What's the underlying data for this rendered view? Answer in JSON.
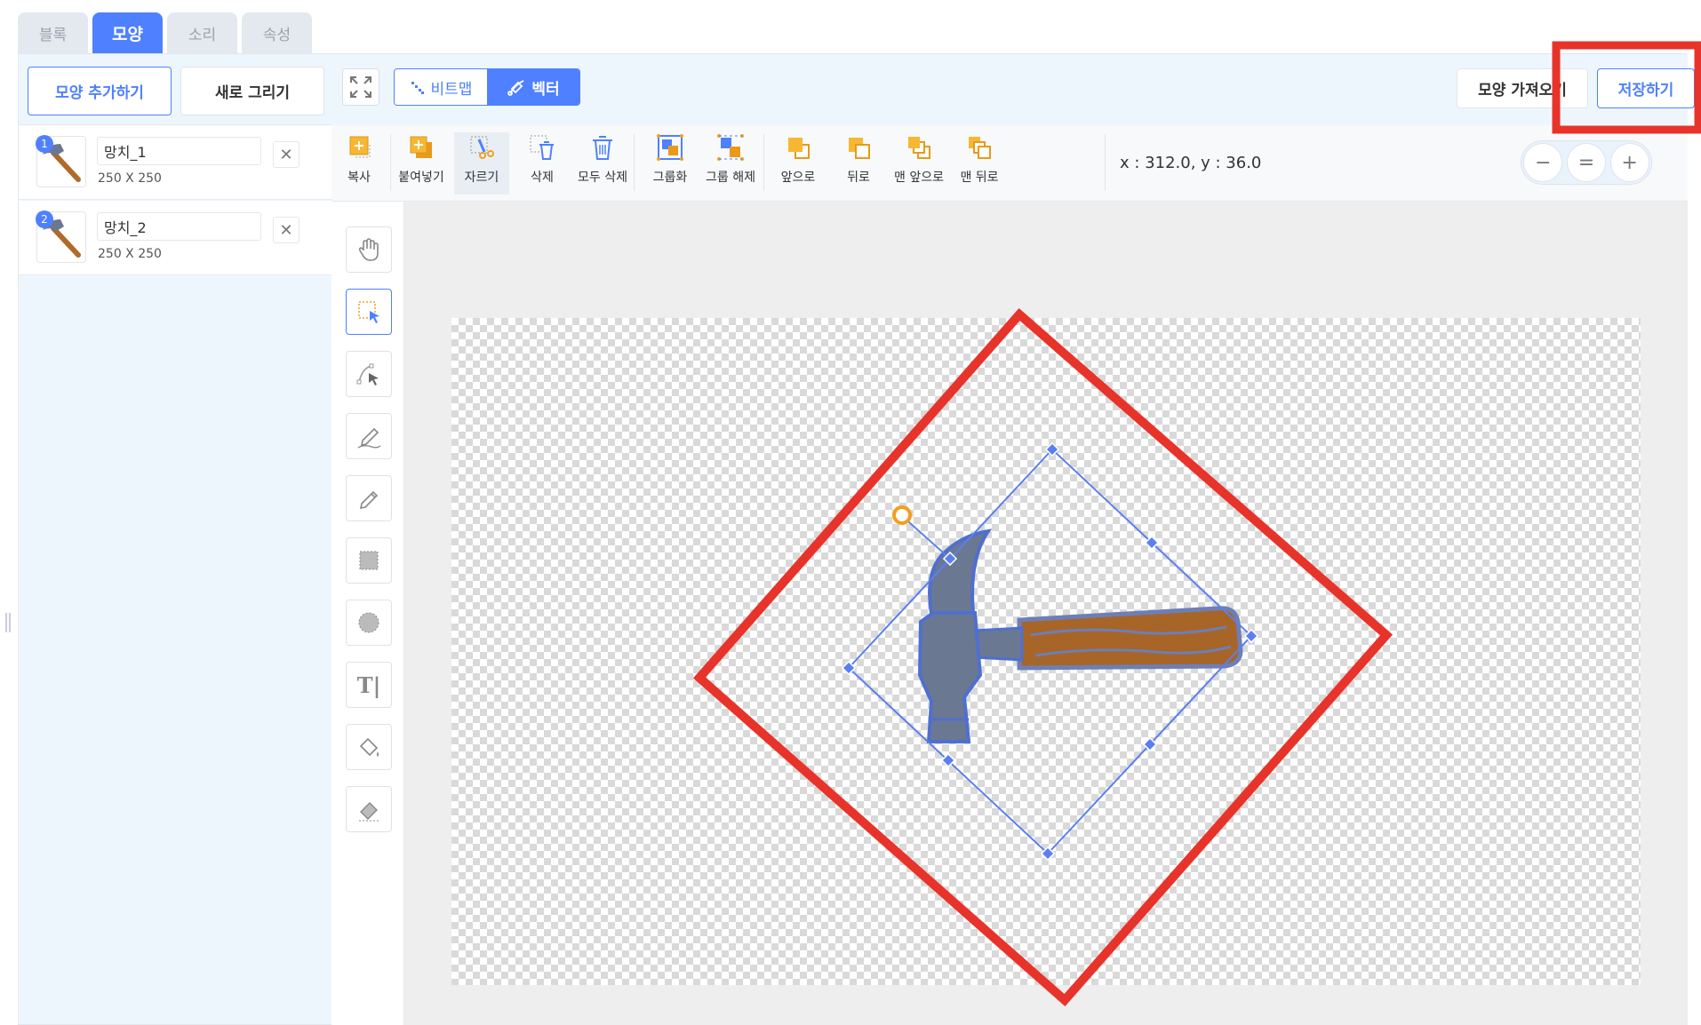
{
  "tabs": [
    {
      "label": "블록"
    },
    {
      "label": "모양"
    },
    {
      "label": "소리"
    },
    {
      "label": "속성"
    }
  ],
  "left_panel": {
    "add_shape_label": "모양 추가하기",
    "new_drawing_label": "새로 그리기",
    "shapes": [
      {
        "number": "1",
        "name": "망치_1",
        "size": "250 X 250"
      },
      {
        "number": "2",
        "name": "망치_2",
        "size": "250 X 250"
      }
    ],
    "delete_symbol": "✕"
  },
  "editor_header": {
    "bitmap_label": "비트맵",
    "vector_label": "벡터",
    "import_label": "모양 가져오기",
    "save_label": "저장하기"
  },
  "toolbar": {
    "copy": "복사",
    "paste": "붙여넣기",
    "cut": "자르기",
    "delete": "삭제",
    "delete_all": "모두 삭제",
    "group": "그룹화",
    "ungroup": "그룹 해제",
    "forward": "앞으로",
    "backward": "뒤로",
    "to_front": "맨 앞으로",
    "to_back": "맨 뒤로",
    "coords": "x : 312.0, y : 36.0",
    "zoom_out": "−",
    "zoom_reset": "=",
    "zoom_in": "+"
  },
  "palette": {
    "text_tool_glyph": "T|"
  },
  "colors": {
    "accent": "#4f80ff",
    "annotation_red": "#e8332a",
    "selection": "#5b7ff0",
    "rotate_handle": "#f0a020",
    "wood": "#b06a2a"
  }
}
